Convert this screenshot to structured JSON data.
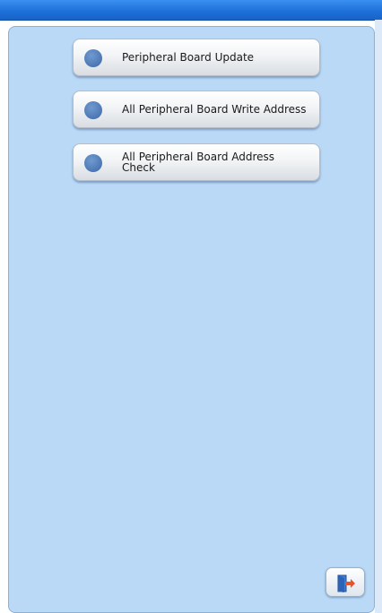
{
  "menu": {
    "items": [
      {
        "label": "Peripheral Board Update"
      },
      {
        "label": "All Peripheral Board Write Address"
      },
      {
        "label": "All Peripheral Board Address Check"
      }
    ]
  },
  "icons": {
    "menu_bullet": "circle-bullet-icon",
    "exit": "exit-door-icon"
  },
  "colors": {
    "titlebar": "#1c6fd8",
    "panel_background": "#b9d9f7",
    "bullet": "#4c77b4",
    "exit_arrow": "#e8542a"
  }
}
